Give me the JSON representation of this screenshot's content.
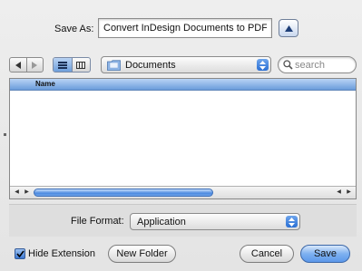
{
  "dialog": {
    "save_as_label": "Save As:",
    "save_as_value": "Convert InDesign Documents to PDF"
  },
  "toolbar": {
    "location": "Documents",
    "search_placeholder": "search",
    "view_mode": "list"
  },
  "browser": {
    "columns": [
      "Name"
    ],
    "items": []
  },
  "accessory": {
    "file_format_label": "File Format:",
    "file_format_value": "Application"
  },
  "footer": {
    "hide_extension_label": "Hide Extension",
    "hide_extension_checked": true,
    "new_folder_label": "New Folder",
    "cancel_label": "Cancel",
    "save_label": "Save"
  },
  "colors": {
    "accent": "#5c98ea",
    "header": "#6a9cdb"
  }
}
